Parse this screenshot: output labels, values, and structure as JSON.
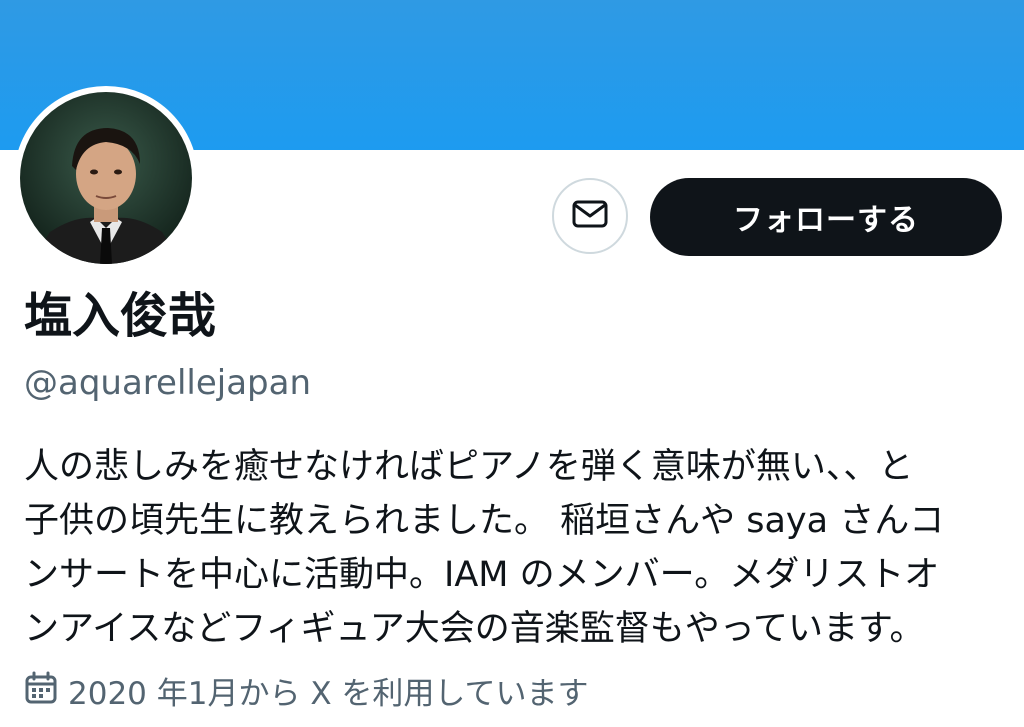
{
  "profile": {
    "display_name": "塩入俊哉",
    "handle": "@aquarellejapan",
    "bio_lines": [
      "人の悲しみを癒せなければピアノを弾く意味が無い、、と",
      "子供の頃先生に教えられました。 稲垣さんや saya さんコ",
      "ンサートを中心に活動中。IAM のメンバー。メダリストオ",
      "ンアイスなどフィギュア大会の音楽監督もやっています。"
    ],
    "joined": "2020 年1月から X を利用しています"
  },
  "actions": {
    "follow_label": "フォローする",
    "message_icon": "envelope-icon"
  },
  "colors": {
    "banner": "#1d9bf0",
    "follow_bg": "#0f1419",
    "secondary_text": "#536471"
  }
}
